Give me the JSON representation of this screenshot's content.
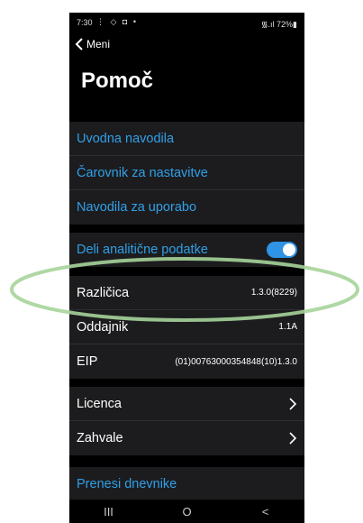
{
  "status_bar": {
    "time": "7:30",
    "icons": "⋮ ◇ ◘ •",
    "right": "᯾.ıl 72%▮"
  },
  "nav": {
    "back_label": "Meni"
  },
  "page": {
    "title": "Pomoč"
  },
  "help_links": [
    {
      "label": "Uvodna navodila"
    },
    {
      "label": "Čarovnik za nastavitve"
    },
    {
      "label": "Navodila za uporabo"
    }
  ],
  "analytics": {
    "label": "Deli analitične podatke",
    "enabled": true
  },
  "info": [
    {
      "label": "Različica",
      "value": "1.3.0(8229)"
    },
    {
      "label": "Oddajnik",
      "value": "1.1A"
    },
    {
      "label": "EIP",
      "value": "(01)00763000354848(10)1.3.0"
    }
  ],
  "legal": [
    {
      "label": "Licenca"
    },
    {
      "label": "Zahvale"
    }
  ],
  "logs": {
    "label": "Prenesi dnevnike"
  },
  "system_nav": {
    "recent": "III",
    "home": "O",
    "back": "<"
  },
  "colors": {
    "link": "#2fa0e8",
    "toggle_on": "#2f93e6",
    "highlight": "#a6d49a",
    "background": "#000000",
    "group": "#1c1c1e"
  }
}
